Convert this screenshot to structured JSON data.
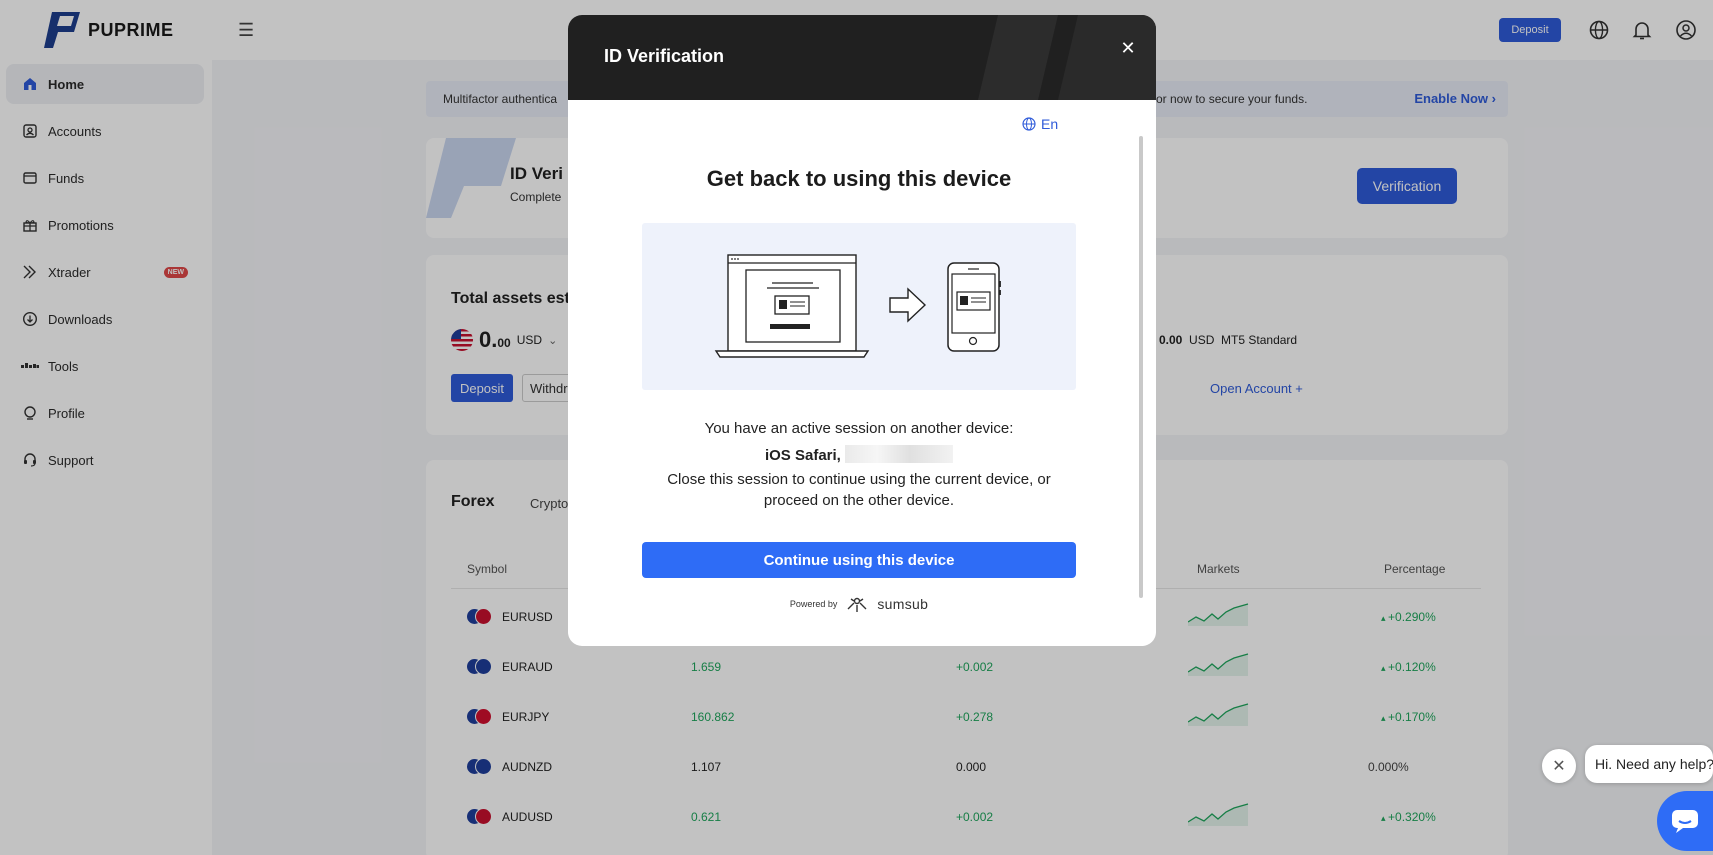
{
  "brand": {
    "name": "PUPRIME"
  },
  "sidebar": {
    "items": [
      {
        "label": "Home",
        "icon": "home-icon"
      },
      {
        "label": "Accounts",
        "icon": "accounts-icon"
      },
      {
        "label": "Funds",
        "icon": "wallet-icon"
      },
      {
        "label": "Promotions",
        "icon": "gift-icon"
      },
      {
        "label": "Xtrader",
        "icon": "xtrader-icon",
        "badge": "NEW"
      },
      {
        "label": "Downloads",
        "icon": "download-icon"
      },
      {
        "label": "Tools",
        "icon": "tools-icon"
      },
      {
        "label": "Profile",
        "icon": "profile-icon"
      },
      {
        "label": "Support",
        "icon": "support-icon"
      }
    ]
  },
  "header": {
    "deposit_label": "Deposit"
  },
  "mfa_banner": {
    "text_left": "Multifactor authentica",
    "text_right": "or now to secure your funds.",
    "action": "Enable Now"
  },
  "id_card": {
    "title": "ID Veri",
    "subtitle": "Complete",
    "button": "Verification"
  },
  "assets": {
    "title": "Total assets esti",
    "amount_int": "0.",
    "amount_dec": "00",
    "currency": "USD",
    "deposit": "Deposit",
    "withdraw": "Withdr",
    "account_amount": "0.00",
    "account_currency": "USD",
    "account_type": "MT5 Standard",
    "open_account": "Open Account +"
  },
  "market": {
    "tabs": [
      "Forex",
      "Crypto"
    ],
    "columns": {
      "symbol": "Symbol",
      "markets": "Markets",
      "percentage": "Percentage"
    },
    "rows": [
      {
        "symbol": "EURUSD",
        "bid": "",
        "change": "",
        "pct": "+0.290%",
        "up": true,
        "flags": [
          "#1f3f9c",
          "#c8102e"
        ]
      },
      {
        "symbol": "EURAUD",
        "bid": "1.659",
        "change": "+0.002",
        "pct": "+0.120%",
        "up": true,
        "flags": [
          "#1f3f9c",
          "#1f3f9c"
        ]
      },
      {
        "symbol": "EURJPY",
        "bid": "160.862",
        "change": "+0.278",
        "pct": "+0.170%",
        "up": true,
        "flags": [
          "#1f3f9c",
          "#d10f2f"
        ]
      },
      {
        "symbol": "AUDNZD",
        "bid": "1.107",
        "change": "0.000",
        "pct": "0.000%",
        "up": false,
        "flags": [
          "#1f3f9c",
          "#1f3f9c"
        ]
      },
      {
        "symbol": "AUDUSD",
        "bid": "0.621",
        "change": "+0.002",
        "pct": "+0.320%",
        "up": true,
        "flags": [
          "#1f3f9c",
          "#c8102e"
        ]
      }
    ]
  },
  "modal": {
    "title": "ID Verification",
    "language": "En",
    "heading": "Get back to using this device",
    "line1": "You have an active session on another device:",
    "device": "iOS Safari,",
    "line3": "Close this session to continue using the current device, or",
    "line4": "proceed on the other device.",
    "continue": "Continue using this device",
    "powered_by": "Powered by",
    "provider": "sumsub"
  },
  "chat": {
    "greeting": "Hi. Need any help?"
  },
  "colors": {
    "accent": "#2f5bd9",
    "modal_button": "#2e6cf6",
    "positive": "#1fa65d"
  }
}
